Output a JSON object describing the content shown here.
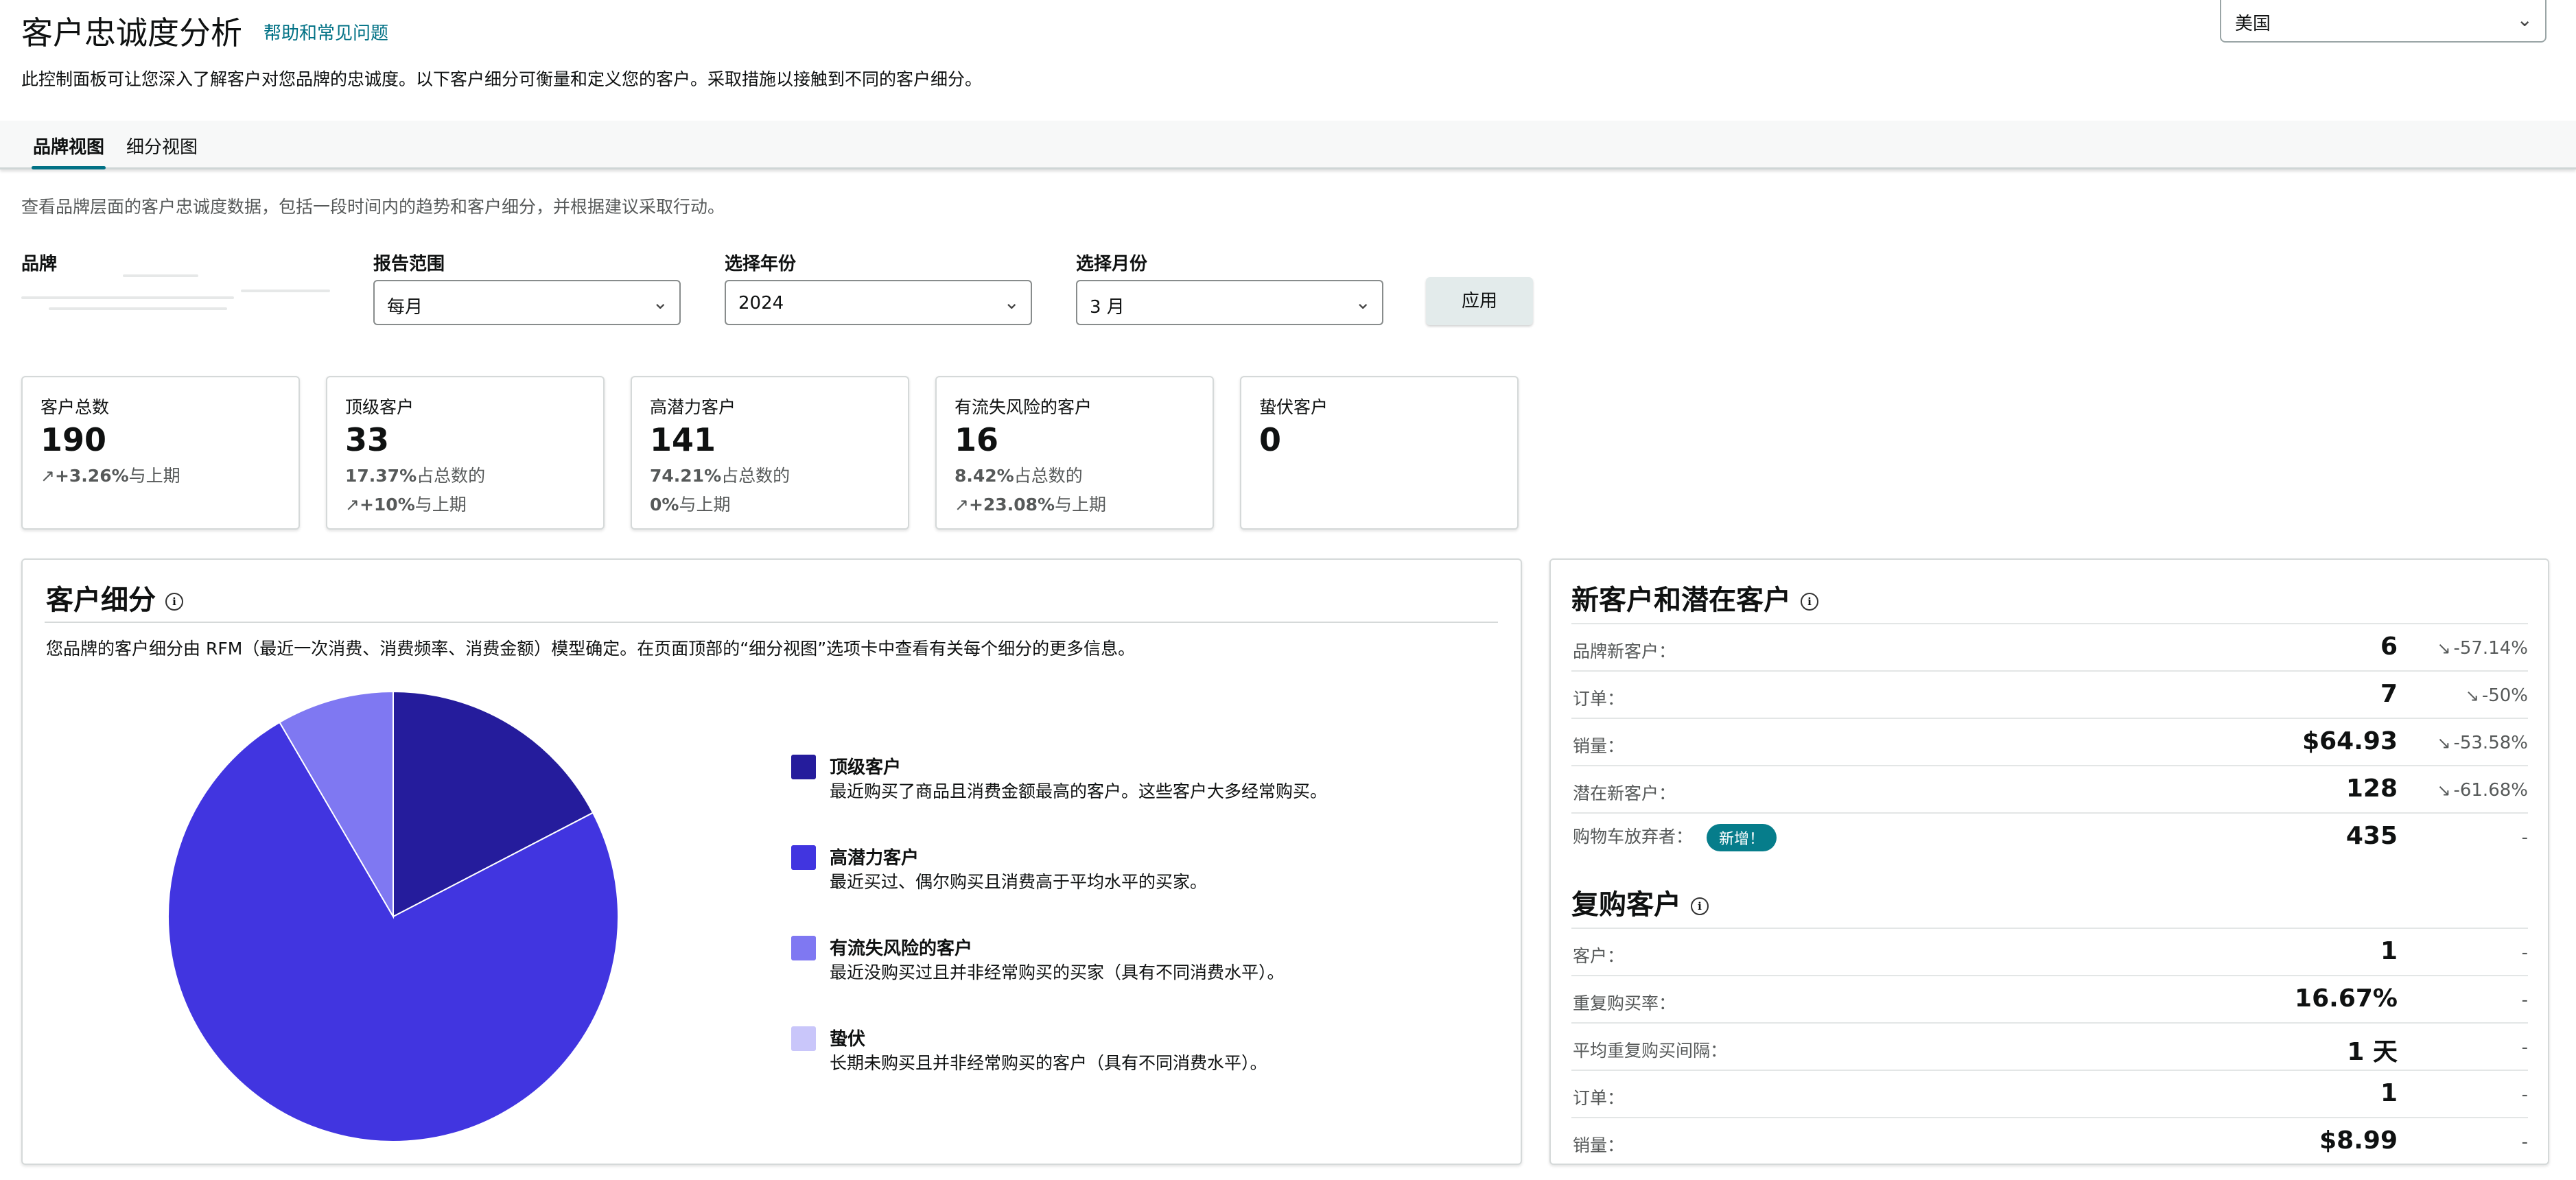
{
  "header": {
    "title": "客户忠诚度分析",
    "help_link": "帮助和常见问题",
    "subtitle": "此控制面板可让您深入了解客户对您品牌的忠诚度。以下客户细分可衡量和定义您的客户。采取措施以接触到不同的客户细分。",
    "country": "美国"
  },
  "tabs": [
    {
      "label": "品牌视图",
      "active": true
    },
    {
      "label": "细分视图",
      "active": false
    }
  ],
  "tab_description": "查看品牌层面的客户忠诚度数据，包括一段时间内的趋势和客户细分，并根据建议采取行动。",
  "filters": {
    "brand_label": "品牌",
    "range_label": "报告范围",
    "range_value": "每月",
    "year_label": "选择年份",
    "year_value": "2024",
    "month_label": "选择月份",
    "month_value": "3 月",
    "apply_label": "应用"
  },
  "cards": [
    {
      "title": "客户总数",
      "value": "190",
      "line1": "",
      "line2_bold": "+3.26%",
      "line2_text": "与上期",
      "line2_trend": "up"
    },
    {
      "title": "顶级客户",
      "value": "33",
      "line1_bold": "17.37%",
      "line1_text": "占总数的",
      "line2_bold": "+10%",
      "line2_text": "与上期",
      "line2_trend": "up"
    },
    {
      "title": "高潜力客户",
      "value": "141",
      "line1_bold": "74.21%",
      "line1_text": "占总数的",
      "line2_bold": "0%",
      "line2_text": "与上期",
      "line2_trend": "none"
    },
    {
      "title": "有流失风险的客户",
      "value": "16",
      "line1_bold": "8.42%",
      "line1_text": "占总数的",
      "line2_bold": "+23.08%",
      "line2_text": "与上期",
      "line2_trend": "up"
    },
    {
      "title": "蛰伏客户",
      "value": "0"
    }
  ],
  "segmentation": {
    "title": "客户细分",
    "description": "您品牌的客户细分由 RFM（最近一次消费、消费频率、消费金额）模型确定。在页面顶部的“细分视图”选项卡中查看有关每个细分的更多信息。",
    "legend": [
      {
        "name": "顶级客户",
        "desc": "最近购买了商品且消费金额最高的客户。这些客户大多经常购买。",
        "color": "#251c9c"
      },
      {
        "name": "高潜力客户",
        "desc": "最近买过、偶尔购买且消费高于平均水平的买家。",
        "color": "#4135e0"
      },
      {
        "name": "有流失风险的客户",
        "desc": "最近没购买过且并非经常购买的买家（具有不同消费水平）。",
        "color": "#7f78f2"
      },
      {
        "name": "蛰伏",
        "desc": "长期未购买且并非经常购买的客户（具有不同消费水平）。",
        "color": "#c9c6fa"
      }
    ]
  },
  "chart_data": {
    "type": "pie",
    "title": "",
    "categories": [
      "顶级客户",
      "高潜力客户",
      "有流失风险的客户",
      "蛰伏"
    ],
    "values": [
      33,
      141,
      16,
      0
    ],
    "colors": [
      "#251c9c",
      "#4135e0",
      "#7f78f2",
      "#c9c6fa"
    ]
  },
  "new_customers": {
    "title": "新客户和潜在客户",
    "rows": [
      {
        "label": "品牌新客户：",
        "value": "6",
        "change": "-57.14%",
        "trend": "down"
      },
      {
        "label": "订单：",
        "value": "7",
        "change": "-50%",
        "trend": "down"
      },
      {
        "label": "销量：",
        "value": "$64.93",
        "change": "-53.58%",
        "trend": "down"
      },
      {
        "label": "潜在新客户：",
        "value": "128",
        "change": "-61.68%",
        "trend": "down"
      },
      {
        "label": "购物车放弃者：",
        "badge": "新增！",
        "value": "435",
        "change": "-",
        "trend": "none"
      }
    ]
  },
  "repeat_customers": {
    "title": "复购客户",
    "rows": [
      {
        "label": "客户：",
        "value": "1",
        "change": "-"
      },
      {
        "label": "重复购买率：",
        "value": "16.67%",
        "change": "-"
      },
      {
        "label": "平均重复购买间隔：",
        "value": "1 天",
        "change": "-"
      },
      {
        "label": "订单：",
        "value": "1",
        "change": "-"
      },
      {
        "label": "销量：",
        "value": "$8.99",
        "change": "-"
      }
    ]
  }
}
